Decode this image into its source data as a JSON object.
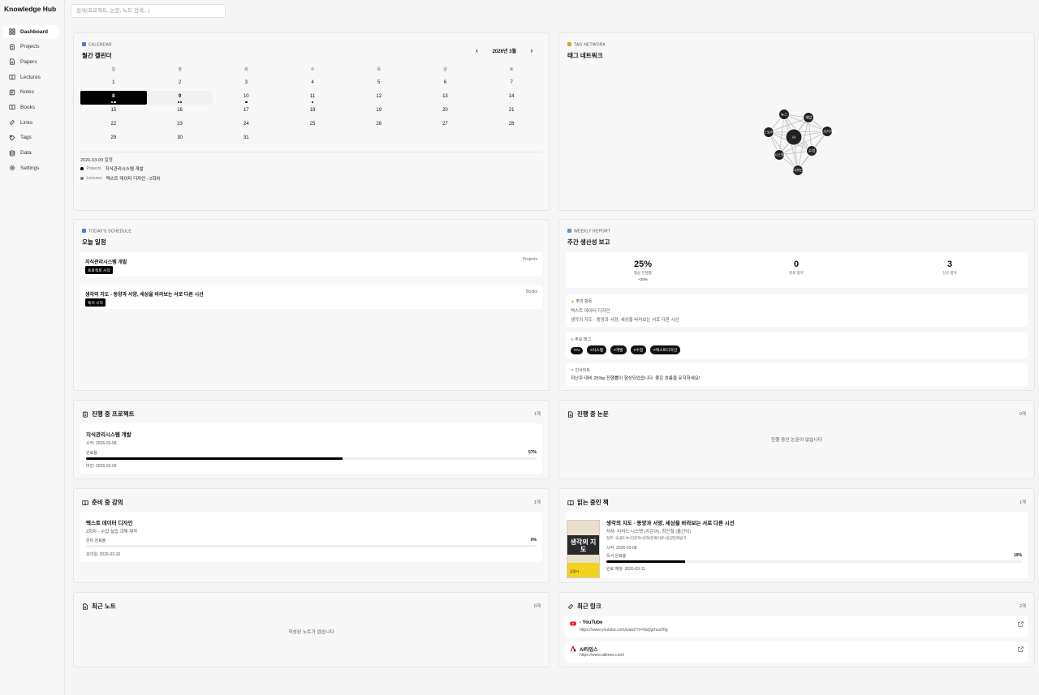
{
  "app": {
    "title": "Knowledge Hub"
  },
  "search": {
    "placeholder": "검색(프로젝트, 논문, 노트 검색...)"
  },
  "sidebar": {
    "items": [
      {
        "label": "Dashboard",
        "icon": "dashboard-icon"
      },
      {
        "label": "Projects",
        "icon": "clipboard-icon"
      },
      {
        "label": "Papers",
        "icon": "file-icon"
      },
      {
        "label": "Lectures",
        "icon": "book-open-icon"
      },
      {
        "label": "Notes",
        "icon": "note-icon"
      },
      {
        "label": "Books",
        "icon": "book-icon"
      },
      {
        "label": "Links",
        "icon": "link-icon"
      },
      {
        "label": "Tags",
        "icon": "tag-icon"
      },
      {
        "label": "Data",
        "icon": "database-icon"
      },
      {
        "label": "Settings",
        "icon": "gear-icon"
      }
    ]
  },
  "calendar": {
    "tag": "CALENDAR",
    "title": "월간 캘린더",
    "month": "2026년 3월",
    "weekdays": [
      "일",
      "월",
      "화",
      "수",
      "목",
      "금",
      "토"
    ],
    "days": [
      "1",
      "2",
      "3",
      "4",
      "5",
      "6",
      "7",
      "8",
      "9",
      "10",
      "11",
      "12",
      "13",
      "14",
      "15",
      "16",
      "17",
      "18",
      "19",
      "20",
      "21",
      "22",
      "23",
      "24",
      "25",
      "26",
      "27",
      "28",
      "29",
      "30",
      "31"
    ],
    "today": "8",
    "selected": "9",
    "dots": {
      "8": 2,
      "9": 2,
      "10": 1,
      "11": 1
    },
    "selected_date": "2026-03-09 일정",
    "events": [
      {
        "source": "Projects",
        "title": "지식관리시스템 개발"
      },
      {
        "source": "Lectures",
        "title": "텍스트 데이터 디자인 - 2회차"
      }
    ]
  },
  "tag_network": {
    "tag": "TAG NETWORK",
    "title": "태그 네트워크",
    "nodes": [
      "AI",
      "뉴스",
      "개발",
      "텍스트디자인",
      "스토리",
      "시스템",
      "수업",
      "디자인"
    ]
  },
  "schedule": {
    "tag": "TODAY'S SCHEDULE",
    "title": "오늘 일정",
    "items": [
      {
        "title": "지식관리시스템 개발",
        "source": "Projects",
        "action": "프로젝트 시작"
      },
      {
        "title": "생각의 지도 - 동양과 서양, 세상을 바라보는 서로 다른 시선",
        "source": "Books",
        "action": "독서 시작"
      }
    ]
  },
  "weekly": {
    "tag": "WEEKLY REPORT",
    "title": "주간 생산성 보고",
    "stats": [
      {
        "value": "25%",
        "label": "평균 진행률",
        "delta": "+25%"
      },
      {
        "value": "0",
        "label": "완료 항목",
        "delta": ""
      },
      {
        "value": "3",
        "label": "신규 항목",
        "delta": ""
      }
    ],
    "attention_label": "주의 항목",
    "attention": [
      "텍스트 데이터 디자인",
      "생각의 지도 - 동양과 서양, 세상을 바라보는 서로 다른 시선"
    ],
    "tags_label": "주요 태그",
    "tags": [
      "#AI",
      "#시스템",
      "#개발",
      "#수업",
      "#텍스트디자인"
    ],
    "insight_label": "인사이트",
    "insight": "지난주 대비 25%p 진행률이 향상되었습니다. 좋은 흐름을 유지하세요!"
  },
  "projects": {
    "title": "진행 중 프로젝트",
    "count": "1개",
    "items": [
      {
        "title": "지식관리시스템 개발",
        "start": "시작: 2026-03-08",
        "label": "완료율",
        "progress": "57%",
        "progress_value": 57,
        "due": "마감: 2026-03-09"
      }
    ]
  },
  "papers": {
    "title": "진행 중 논문",
    "count": "0개",
    "empty": "진행 중인 논문이 없습니다"
  },
  "lectures": {
    "title": "준비 중 강의",
    "count": "1개",
    "items": [
      {
        "title": "텍스트 데이터 디자인",
        "subtitle": "2회차 - 수업 실습 과제 제작",
        "label": "준비 완료율",
        "progress": "0%",
        "progress_value": 0,
        "date": "강의일: 2026-03-10"
      }
    ]
  },
  "books": {
    "title": "읽는 중인 책",
    "count": "1개",
    "items": [
      {
        "title": "생각의 지도 - 동양과 서양, 세상을 바라보는 서로 다른 시선",
        "author": "저자: 리처드 니스벳 (지은이), 최인철 (옮긴이)",
        "category": "장르: 국내도서>인문학>문화/문화이론>동양문화읽기",
        "start": "시작: 2026-03-08",
        "label": "독서 완료율",
        "progress": "19%",
        "progress_value": 19,
        "due": "완료 예정: 2026-03-11",
        "cover_title": "생각의 지도",
        "cover_publisher": "김영사"
      }
    ]
  },
  "notes": {
    "title": "최근 노트",
    "count": "0개",
    "empty": "작성된 노트가 없습니다"
  },
  "links": {
    "title": "최근 링크",
    "count": "2개",
    "items": [
      {
        "title": "- YouTube",
        "url": "https://www.youtube.com/watch?v=9aQgrhux26g",
        "icon": "youtube-icon",
        "color": "#ff0000"
      },
      {
        "title": "AI타임스",
        "url": "https://www.aitimes.com/",
        "icon": "aitimes-icon",
        "color": "#d0021b"
      }
    ]
  },
  "colors": {
    "accent": "#000000",
    "panel": "#f7f7f7",
    "calendar_tag": "#4a7bd6",
    "tag_network_tag": "#e0a030",
    "weekly_tag": "#6a8fc8"
  }
}
